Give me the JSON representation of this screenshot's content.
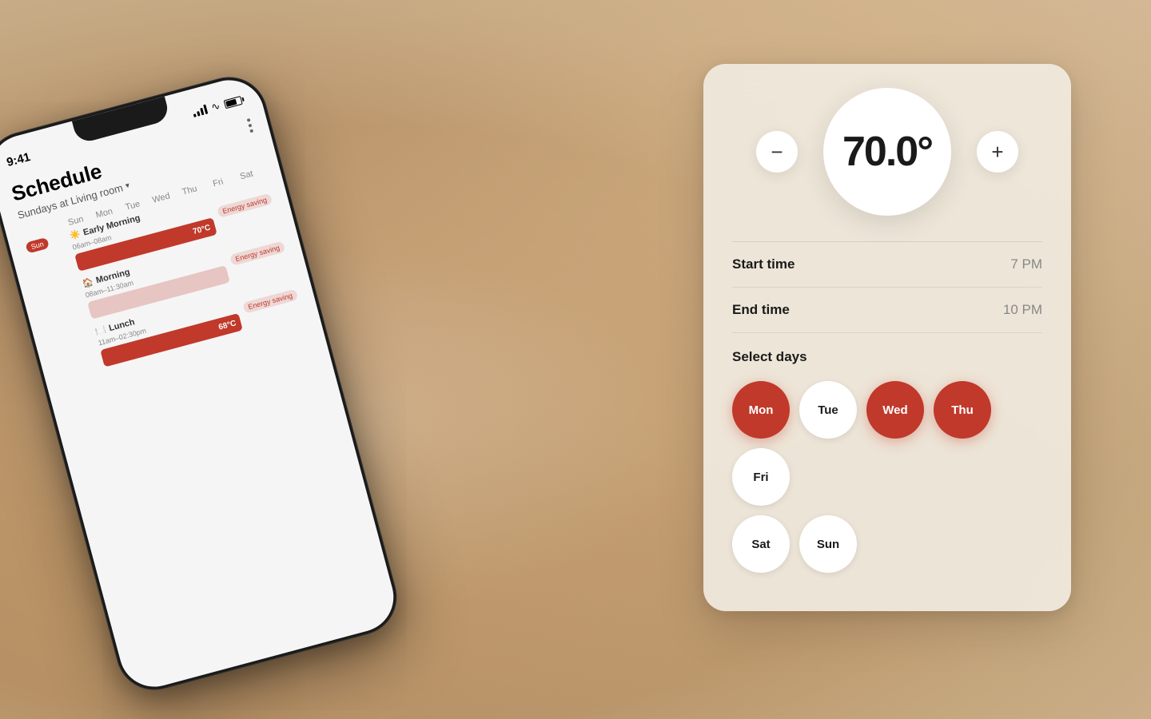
{
  "background": {
    "color": "#c4a882"
  },
  "phone": {
    "status_time": "9:41",
    "location": "Living room",
    "schedule_title": "Schedule",
    "schedule_subtitle": "Sundays at Living room",
    "days_header": [
      "Sun",
      "Mon",
      "Tue",
      "Wed",
      "Thu",
      "Fri",
      "Sat"
    ],
    "menu_label": "⋮",
    "rows": [
      {
        "id": "early-morning",
        "icon": "☀",
        "name": "Early Morning",
        "time": "06am–08am",
        "has_sun_badge": true,
        "bar_type": "red",
        "temp": "",
        "energy": "Energy saving"
      },
      {
        "id": "morning",
        "icon": "🏠",
        "name": "Morning",
        "time": "08am–11:30am",
        "has_sun_badge": false,
        "bar_type": "pink",
        "temp": "",
        "energy": "Energy saving"
      },
      {
        "id": "lunch",
        "icon": "",
        "name": "Lunch",
        "time": "11am–02:30pm",
        "has_sun_badge": false,
        "bar_type": "red",
        "temp": "68°C",
        "energy": "Energy saving"
      }
    ]
  },
  "thermostat": {
    "temperature": "70.0°",
    "minus_btn": "−",
    "plus_btn": "+",
    "start_time_label": "Start time",
    "start_time_value": "7 PM",
    "end_time_label": "End time",
    "end_time_value": "10 PM",
    "select_days_label": "Select days",
    "days": [
      {
        "id": "mon",
        "label": "Mon",
        "active": true
      },
      {
        "id": "tue",
        "label": "Tue",
        "active": false
      },
      {
        "id": "wed",
        "label": "Wed",
        "active": true
      },
      {
        "id": "thu",
        "label": "Thu",
        "active": true
      },
      {
        "id": "fri",
        "label": "Fri",
        "active": false
      },
      {
        "id": "sat",
        "label": "Sat",
        "active": false
      },
      {
        "id": "sun",
        "label": "Sun",
        "active": false
      }
    ],
    "colors": {
      "active_bg": "#c0392b",
      "active_text": "#ffffff",
      "inactive_bg": "#ffffff",
      "inactive_text": "#1a1a1a"
    }
  }
}
